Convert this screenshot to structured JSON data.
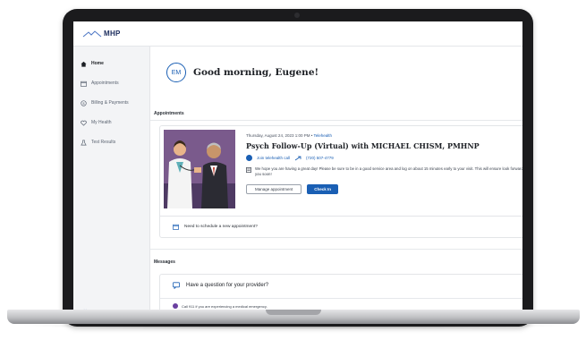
{
  "app": {
    "logo": "MHP"
  },
  "sidebar": {
    "items": [
      {
        "label": "Home",
        "icon": "home-icon",
        "active": true
      },
      {
        "label": "Appointments",
        "icon": "calendar-icon",
        "active": false
      },
      {
        "label": "Billing & Payments",
        "icon": "billing-icon",
        "active": false
      },
      {
        "label": "My Health",
        "icon": "heart-icon",
        "active": false
      },
      {
        "label": "Test Results",
        "icon": "flask-icon",
        "active": false
      }
    ],
    "collapse_label": "«"
  },
  "greeting": {
    "initials": "EM",
    "text": "Good morning, Eugene!"
  },
  "appointments": {
    "section_title": "Appointments",
    "date_text": "Thursday, August 24, 2023 1:00 PM •",
    "type_tag": "Telehealth",
    "title": "Psych Follow-Up (Virtual) with MICHAEL CHISM, PMHNP",
    "join_label": "Join telehealth call",
    "phone": "(720) 507-4779",
    "note": "We hope you are having a great day! Please be sure to be in a good service area and log on about 15 minutes early to your visit. This will ensure look forward to seeing you soon!",
    "manage_label": "Manage appointment",
    "checkin_label": "Check In",
    "schedule_label": "Need to schedule a new appointment?"
  },
  "messages": {
    "section_title": "Messages",
    "question_label": "Have a question for your provider?",
    "emergency_text": "Call 911 if you are experiencing a medical emergency.",
    "visited_text": "Once you have visited us, you can message your provider here."
  },
  "colors": {
    "accent": "#1a5fb4",
    "sidebar_bg": "#f3f4f6",
    "illustration_bg": "#6b4f7b"
  }
}
